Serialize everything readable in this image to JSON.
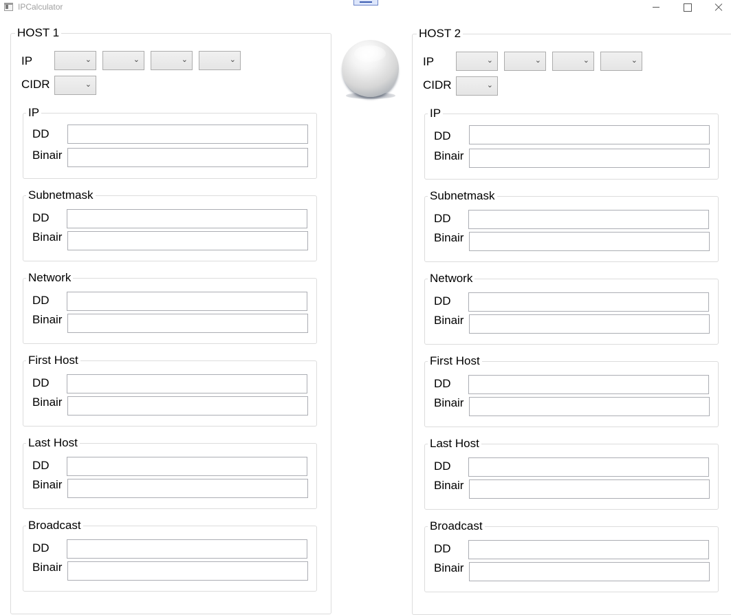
{
  "window": {
    "title": "IPCalculator"
  },
  "hosts": [
    {
      "title": "HOST 1",
      "ip_label": "IP",
      "cidr_label": "CIDR",
      "ip_octets": [
        "",
        "",
        "",
        ""
      ],
      "cidr_value": "",
      "sections": [
        {
          "title": "IP",
          "dd_label": "DD",
          "bin_label": "Binair",
          "dd_value": "",
          "bin_value": ""
        },
        {
          "title": "Subnetmask",
          "dd_label": "DD",
          "bin_label": "Binair",
          "dd_value": "",
          "bin_value": ""
        },
        {
          "title": "Network",
          "dd_label": "DD",
          "bin_label": "Binair",
          "dd_value": "",
          "bin_value": ""
        },
        {
          "title": "First Host",
          "dd_label": "DD",
          "bin_label": "Binair",
          "dd_value": "",
          "bin_value": ""
        },
        {
          "title": "Last Host",
          "dd_label": "DD",
          "bin_label": "Binair",
          "dd_value": "",
          "bin_value": ""
        },
        {
          "title": "Broadcast",
          "dd_label": "DD",
          "bin_label": "Binair",
          "dd_value": "",
          "bin_value": ""
        }
      ]
    },
    {
      "title": "HOST 2",
      "ip_label": "IP",
      "cidr_label": "CIDR",
      "ip_octets": [
        "",
        "",
        "",
        ""
      ],
      "cidr_value": "",
      "sections": [
        {
          "title": "IP",
          "dd_label": "DD",
          "bin_label": "Binair",
          "dd_value": "",
          "bin_value": ""
        },
        {
          "title": "Subnetmask",
          "dd_label": "DD",
          "bin_label": "Binair",
          "dd_value": "",
          "bin_value": ""
        },
        {
          "title": "Network",
          "dd_label": "DD",
          "bin_label": "Binair",
          "dd_value": "",
          "bin_value": ""
        },
        {
          "title": "First Host",
          "dd_label": "DD",
          "bin_label": "Binair",
          "dd_value": "",
          "bin_value": ""
        },
        {
          "title": "Last Host",
          "dd_label": "DD",
          "bin_label": "Binair",
          "dd_value": "",
          "bin_value": ""
        },
        {
          "title": "Broadcast",
          "dd_label": "DD",
          "bin_label": "Binair",
          "dd_value": "",
          "bin_value": ""
        }
      ]
    }
  ],
  "icons": {
    "app": "app-window-icon",
    "menu": "menu-handle-icon",
    "center": "sphere-icon",
    "combo": "chevron-down-icon"
  }
}
